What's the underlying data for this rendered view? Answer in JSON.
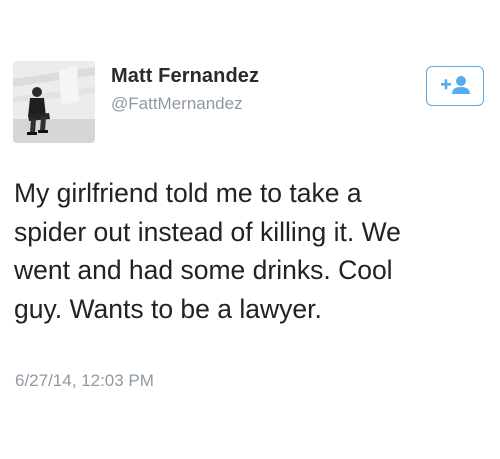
{
  "author": {
    "display_name": "Matt Fernandez",
    "handle": "@FattMernandez",
    "avatar_icon": "user-photo"
  },
  "follow_button": {
    "icon": "add-user-icon",
    "accent_color": "#55acee"
  },
  "tweet": {
    "text_lines": [
      "My girlfriend told me to take a",
      "spider out instead of killing it. We",
      "went and had some drinks. Cool",
      "guy. Wants to be a lawyer."
    ],
    "timestamp": "6/27/14, 12:03 PM"
  },
  "colors": {
    "text": "#222222",
    "muted": "#8f99a2",
    "accent": "#55acee",
    "background": "#ffffff"
  }
}
